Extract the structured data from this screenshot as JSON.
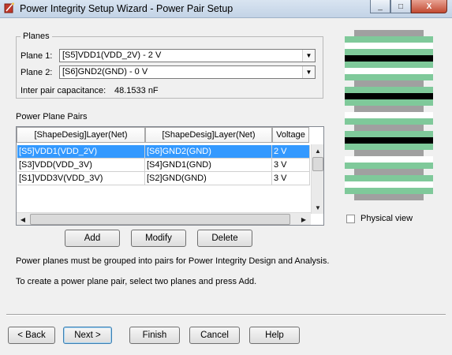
{
  "window": {
    "title": "Power Integrity Setup Wizard - Power Pair Setup",
    "minimize": "_",
    "maximize": "□",
    "close": "X"
  },
  "planes": {
    "legend": "Planes",
    "plane1_label": "Plane 1:",
    "plane1_value": "[S5]VDD1(VDD_2V) - 2 V",
    "plane2_label": "Plane 2:",
    "plane2_value": "[S6]GND2(GND) - 0 V",
    "capacitance_label": "Inter pair capacitance:",
    "capacitance_value": "48.1533 nF"
  },
  "pairs": {
    "label": "Power Plane Pairs",
    "columns": [
      "[ShapeDesig]Layer(Net)",
      "[ShapeDesig]Layer(Net)",
      "Voltage"
    ],
    "rows": [
      {
        "a": "[S5]VDD1(VDD_2V)",
        "b": "[S6]GND2(GND)",
        "v": "2 V",
        "selected": true
      },
      {
        "a": "[S3]VDD(VDD_3V)",
        "b": "[S4]GND1(GND)",
        "v": "3 V",
        "selected": false
      },
      {
        "a": "[S1]VDD3V(VDD_3V)",
        "b": "[S2]GND(GND)",
        "v": "3 V",
        "selected": false
      }
    ],
    "add": "Add",
    "modify": "Modify",
    "delete": "Delete"
  },
  "info": {
    "line1": "Power planes must be grouped into pairs for Power Integrity Design and Analysis.",
    "line2": "To create a power plane pair, select two planes and press Add."
  },
  "stack": {
    "colors": {
      "gray": "#a0a0a0",
      "green": "#7fc99a",
      "black": "#000000",
      "white": "#ffffff"
    },
    "layers": [
      "gray",
      "green",
      "white",
      "green",
      "black",
      "green",
      "white",
      "green",
      "gray",
      "green",
      "black",
      "green",
      "gray",
      "white",
      "green",
      "gray",
      "green",
      "black",
      "green",
      "gray",
      "white",
      "green",
      "gray",
      "green",
      "white",
      "green",
      "gray"
    ]
  },
  "physical_view_label": "Physical view",
  "footer": {
    "back": "< Back",
    "next": "Next >",
    "finish": "Finish",
    "cancel": "Cancel",
    "help": "Help"
  },
  "colors": {
    "selection": "#3399ff"
  }
}
